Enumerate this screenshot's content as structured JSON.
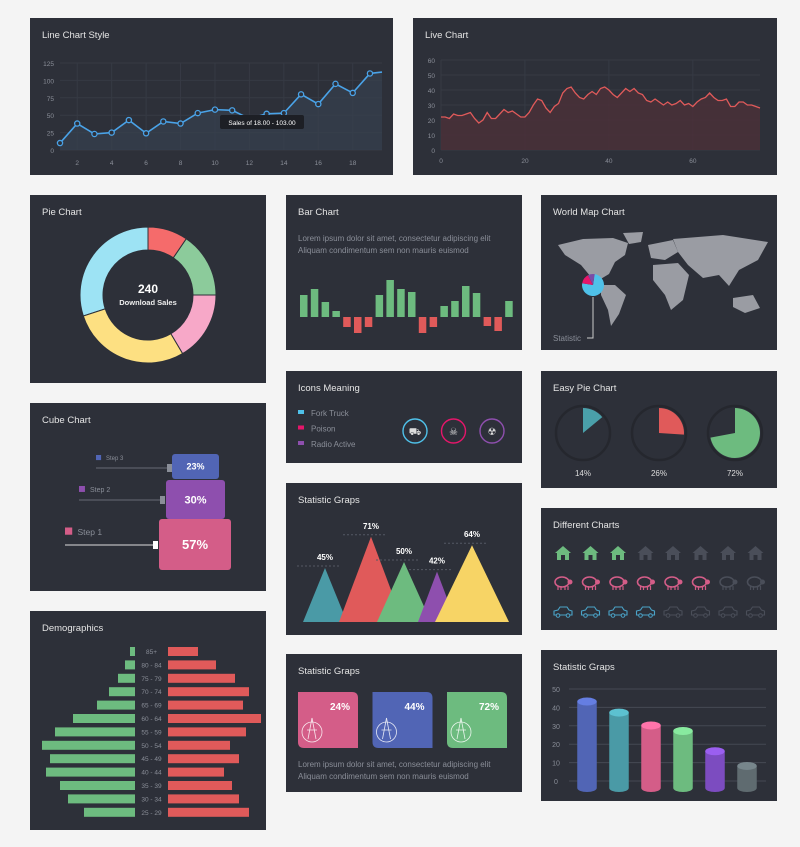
{
  "colors": {
    "background": "#f4f4f4",
    "panel": "#2d3039",
    "green": "#6dbb7f",
    "red": "#e05a5a",
    "blue": "#4aa3e8",
    "pink": "#d45d88",
    "indigo": "#5165b5",
    "purple": "#8e4fae",
    "teal": "#4aa0aa",
    "yellow": "#f7d465"
  },
  "lorem": {
    "line1": "Lorem ipsum dolor sit amet, consectetur adipiscing elit",
    "line2": "Aliquam condimentum sem non mauris euismod"
  },
  "chart_data": [
    {
      "id": "line",
      "type": "line",
      "title": "Line Chart Style",
      "x": [
        1,
        2,
        3,
        4,
        5,
        6,
        7,
        8,
        9,
        10,
        11,
        12,
        13,
        14,
        15,
        16,
        17,
        18,
        19,
        19.7
      ],
      "y": [
        10,
        38,
        23,
        25,
        43,
        24,
        41,
        38,
        53,
        58,
        57,
        45,
        52,
        53,
        80,
        66,
        95,
        82,
        110,
        112
      ],
      "xticks": [
        "2",
        "4",
        "6",
        "8",
        "10",
        "12",
        "14",
        "16",
        "18"
      ],
      "yticks": [
        "0",
        "25",
        "50",
        "75",
        "100",
        "125"
      ],
      "xlim": [
        1,
        19.7
      ],
      "ylim": [
        0,
        125
      ],
      "grid": true,
      "color": "#4aa3e8",
      "tooltip": "Sales of 18.00 - 103.00"
    },
    {
      "id": "live",
      "type": "area",
      "title": "Live Chart",
      "y": [
        22,
        22,
        21,
        24,
        23,
        23,
        24,
        25,
        21,
        18,
        20,
        25,
        21,
        21,
        24,
        27,
        25,
        26,
        24,
        22,
        22,
        25,
        30,
        34,
        33,
        28,
        25,
        29,
        31,
        38,
        41,
        42,
        38,
        35,
        34,
        37,
        39,
        37,
        41,
        42,
        40,
        37,
        35,
        38,
        41,
        39,
        41,
        38,
        37,
        33,
        32,
        34,
        32,
        30,
        32,
        30,
        31,
        33,
        30,
        31,
        29,
        32,
        34,
        35,
        38,
        35,
        33,
        33,
        34,
        29,
        29,
        32,
        32,
        30,
        30,
        29,
        28
      ],
      "xticks": [
        "0",
        "20",
        "40",
        "60"
      ],
      "yticks": [
        "0",
        "10",
        "20",
        "30",
        "40",
        "50",
        "60"
      ],
      "xlim": [
        0,
        76
      ],
      "ylim": [
        0,
        60
      ],
      "grid": true,
      "color": "#e05a5a"
    },
    {
      "id": "pie",
      "type": "pie",
      "title": "Pie Chart",
      "center_value": "240",
      "center_label": "Download Sales",
      "values": [
        9.5,
        15.5,
        16.5,
        28.5,
        30
      ],
      "colors": [
        "#f56b6b",
        "#8ccb9b",
        "#f7a8c8",
        "#fde082",
        "#9de3f4"
      ]
    },
    {
      "id": "bars",
      "type": "bar",
      "title": "Bar Chart",
      "values": [
        22,
        28,
        15,
        6,
        -10,
        -16,
        -10,
        22,
        37,
        28,
        25,
        -16,
        -10,
        11,
        16,
        31,
        24,
        -9,
        -14,
        16
      ]
    },
    {
      "id": "map",
      "type": "map",
      "title": "World Map Chart",
      "label": "Statistic",
      "slices": [
        75,
        15,
        10
      ],
      "colors": [
        "#4fc1e9",
        "#e5166a",
        "#7a4ca6"
      ]
    },
    {
      "id": "icons",
      "type": "legend",
      "title": "Icons Meaning",
      "items": [
        {
          "label": "Fork Truck",
          "color": "#4fc1e9",
          "icon": "forklift-icon"
        },
        {
          "label": "Poison",
          "color": "#e5166a",
          "icon": "skull-icon"
        },
        {
          "label": "Radio Active",
          "color": "#8e4fae",
          "icon": "radioactive-icon"
        }
      ]
    },
    {
      "id": "easypie",
      "type": "pie",
      "title": "Easy Pie Chart",
      "values": [
        14,
        26,
        72
      ],
      "labels": [
        "14%",
        "26%",
        "72%"
      ],
      "colors": [
        "#4aa0aa",
        "#e05a5a",
        "#6dbb7f"
      ]
    },
    {
      "id": "cube",
      "type": "bar",
      "title": "Cube Chart",
      "items": [
        {
          "label": "Step 3",
          "value": "23%",
          "color": "#5165b5"
        },
        {
          "label": "Step 2",
          "value": "30%",
          "color": "#8e4fae"
        },
        {
          "label": "Step 1",
          "value": "57%",
          "color": "#d45d88"
        }
      ]
    },
    {
      "id": "triangles",
      "type": "bar",
      "title": "Statistic Graps",
      "values": [
        45,
        71,
        50,
        42,
        64
      ],
      "labels": [
        "45%",
        "71%",
        "50%",
        "42%",
        "64%"
      ],
      "colors": [
        "#4a9aa6",
        "#e05a5a",
        "#6dbb7f",
        "#8e4fae",
        "#f7d465"
      ]
    },
    {
      "id": "pictogram",
      "type": "pictogram",
      "title": "Different Charts",
      "rows": [
        {
          "icon": "house-icon",
          "filled": 3,
          "total": 8,
          "color": "#6dbb7f"
        },
        {
          "icon": "sheep-icon",
          "filled": 6,
          "total": 8,
          "color": "#d45d88"
        },
        {
          "icon": "car-icon",
          "filled": 4,
          "total": 8,
          "color": "#4aa3c8"
        }
      ]
    },
    {
      "id": "demographics",
      "type": "bar",
      "title": "Demographics",
      "categories": [
        "85+",
        "80 - 84",
        "75 - 79",
        "70 - 74",
        "65 - 69",
        "60 - 64",
        "55 - 59",
        "50 - 54",
        "45 - 49",
        "40 - 44",
        "35 - 39",
        "30 - 34",
        "25 - 29"
      ],
      "series": [
        {
          "values": [
            5,
            10,
            17,
            26,
            38,
            62,
            80,
            93,
            85,
            89,
            75,
            67,
            51
          ],
          "color": "#6dbb7f"
        },
        {
          "values": [
            30,
            48,
            67,
            81,
            75,
            93,
            78,
            62,
            71,
            56,
            64,
            71,
            81
          ],
          "color": "#e05a5a"
        }
      ]
    },
    {
      "id": "cards",
      "type": "table",
      "title": "Statistic Graps",
      "items": [
        {
          "value": "24%",
          "color": "#d45d88",
          "icon": "tower-icon"
        },
        {
          "value": "44%",
          "color": "#5165b5",
          "icon": "temple-icon"
        },
        {
          "value": "72%",
          "color": "#6dbb7f",
          "icon": "statue-icon"
        }
      ]
    },
    {
      "id": "cylinders",
      "type": "bar",
      "title": "Statistic Graps",
      "values": [
        41,
        35,
        28,
        25,
        14,
        6
      ],
      "yticks": [
        "0",
        "10",
        "20",
        "30",
        "40",
        "50"
      ],
      "ylim": [
        0,
        50
      ],
      "grid": true,
      "colors": [
        "#5165b5",
        "#4a9aa6",
        "#d45d88",
        "#6dbb7f",
        "#7c4cc0",
        "#5f6b70"
      ]
    }
  ]
}
